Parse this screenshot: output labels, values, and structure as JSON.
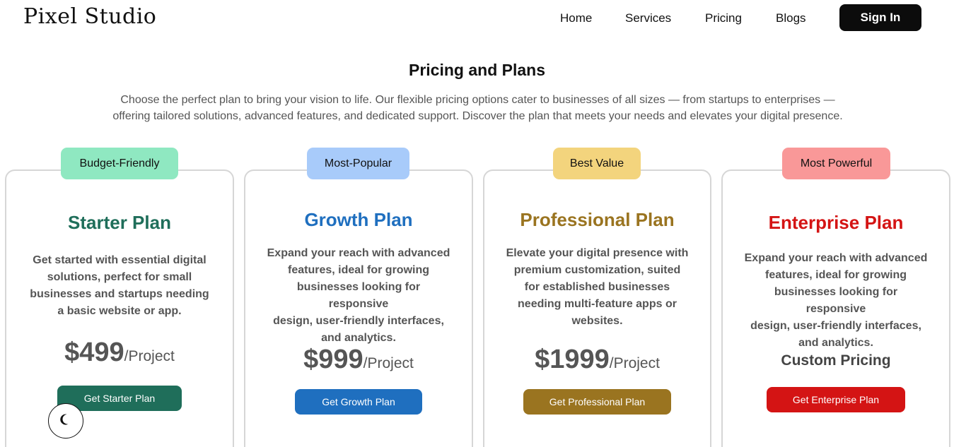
{
  "header": {
    "logo": "Pixel Studio",
    "nav": [
      "Home",
      "Services",
      "Pricing",
      "Blogs"
    ],
    "signin": "Sign In"
  },
  "hero": {
    "title": "Pricing and Plans",
    "intro_line1": "Choose the perfect plan to bring your vision to life. Our flexible pricing options cater to businesses of all sizes — from startups to enterprises —",
    "intro_line2": "offering tailored solutions, advanced features, and dedicated support. Discover the plan that meets your needs and elevates your digital presence."
  },
  "plans": [
    {
      "badge": "Budget-Friendly",
      "badge_color": "#8fe8c1",
      "name": "Starter Plan",
      "color": "#1f6e5a",
      "desc": [
        "Get started with essential digital",
        "solutions, perfect for small",
        "businesses and startups needing",
        "a basic website or app."
      ],
      "price": "$499",
      "unit": "/Project",
      "cta": "Get Starter Plan"
    },
    {
      "badge": "Most-Popular",
      "badge_color": "#a8cbfa",
      "name": "Growth Plan",
      "color": "#1f6fbf",
      "desc": [
        "Expand your reach with advanced",
        "features, ideal for growing",
        "businesses looking for responsive",
        "design, user-friendly interfaces,",
        "and analytics."
      ],
      "price": "$999",
      "unit": "/Project",
      "cta": "Get Growth Plan"
    },
    {
      "badge": "Best Value",
      "badge_color": "#f3d47d",
      "name": "Professional Plan",
      "color": "#9a7420",
      "desc": [
        "Elevate your digital presence with",
        "premium customization, suited",
        "for established businesses",
        "needing multi-feature apps or",
        "websites."
      ],
      "price": "$1999",
      "unit": "/Project",
      "cta": "Get Professional Plan"
    },
    {
      "badge": "Most Powerful",
      "badge_color": "#f99898",
      "name": "Enterprise Plan",
      "color": "#d41414",
      "desc": [
        "Expand your reach with advanced",
        "features, ideal for growing",
        "businesses looking for responsive",
        "design, user-friendly interfaces,",
        "and analytics."
      ],
      "custom": "Custom Pricing",
      "cta": "Get Enterprise Plan"
    }
  ],
  "theme_toggle_icon": "moon-icon"
}
